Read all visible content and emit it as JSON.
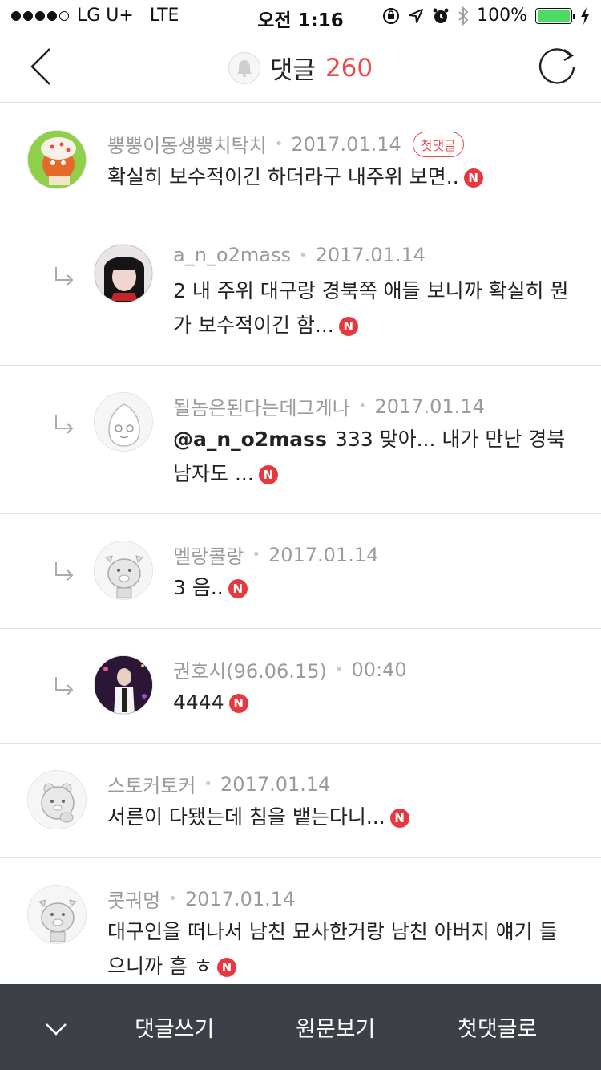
{
  "status_bar": {
    "carrier": "LG U+",
    "network": "LTE",
    "time": "오전 1:16",
    "battery": "100%",
    "battery_level": 1.0
  },
  "nav": {
    "title": "댓글",
    "count": "260",
    "back_icon": "chevron-left-icon",
    "refresh_icon": "refresh-icon",
    "bell_icon": "bell-icon"
  },
  "colors": {
    "accent": "#e84b4b",
    "new_badge": "#e8383f",
    "bottom_bar": "#3d4046",
    "meta_text": "#9b9b9b"
  },
  "new_badge_label": "N",
  "comments": [
    {
      "author": "뿡뿡이동생뿡치탁치",
      "date": "2017.01.14",
      "badge": "첫댓글",
      "text": "확실히 보수적이긴 하더라구 내주위 보면..",
      "reply": false
    },
    {
      "author": "a_n_o2mass",
      "date": "2017.01.14",
      "text": "2 내 주위 대구랑 경북쪽 애들 보니까 확실히 뭔가 보수적이긴 함...",
      "reply": true
    },
    {
      "author": "될놈은된다는데그게나",
      "date": "2017.01.14",
      "mention": "@a_n_o2mass",
      "text": "333 맞아... 내가 만난 경북 남자도 ...",
      "reply": true
    },
    {
      "author": "멜랑콜랑",
      "date": "2017.01.14",
      "text": "3 음..",
      "reply": true
    },
    {
      "author": "권호시(96.06.15)",
      "date": "00:40",
      "text": "4444",
      "reply": true
    },
    {
      "author": "스토커토커",
      "date": "2017.01.14",
      "text": "서른이 다됐는데 침을 뱉는다니...",
      "reply": false
    },
    {
      "author": "콧궈멍",
      "date": "2017.01.14",
      "text": "대구인을 떠나서 남친 묘사한거랑 남친 아버지 얘기 들으니까 흠 ㅎ",
      "reply": false
    }
  ],
  "bottom_bar": {
    "collapse_icon": "chevron-down-icon",
    "write": "댓글쓰기",
    "original": "원문보기",
    "first": "첫댓글로"
  }
}
